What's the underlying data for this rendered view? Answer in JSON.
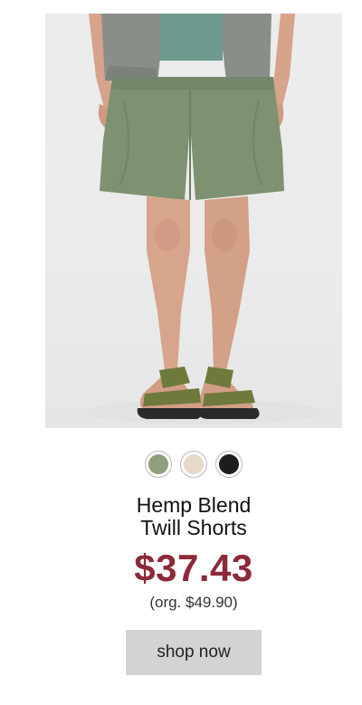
{
  "product": {
    "image_alt": "Hemp Blend Twill Shorts worn by model with green sandals",
    "title_line1": "Hemp Blend",
    "title_line2": "Twill Shorts",
    "price": "$37.43",
    "original_price": "(org. $49.90)",
    "cta_label": "shop now"
  },
  "swatches": [
    {
      "name": "green",
      "color": "#8f9e7c"
    },
    {
      "name": "beige",
      "color": "#e8d8c8"
    },
    {
      "name": "black",
      "color": "#1c1c1c"
    }
  ],
  "colors": {
    "price": "#8c2a3a",
    "button_bg": "#d3d3d3",
    "shorts": "#7e9170",
    "shirt": "#8a8e88",
    "tee": "#6f9a90",
    "skin": "#d7a48c",
    "sandal_strap": "#6e7a3c"
  }
}
